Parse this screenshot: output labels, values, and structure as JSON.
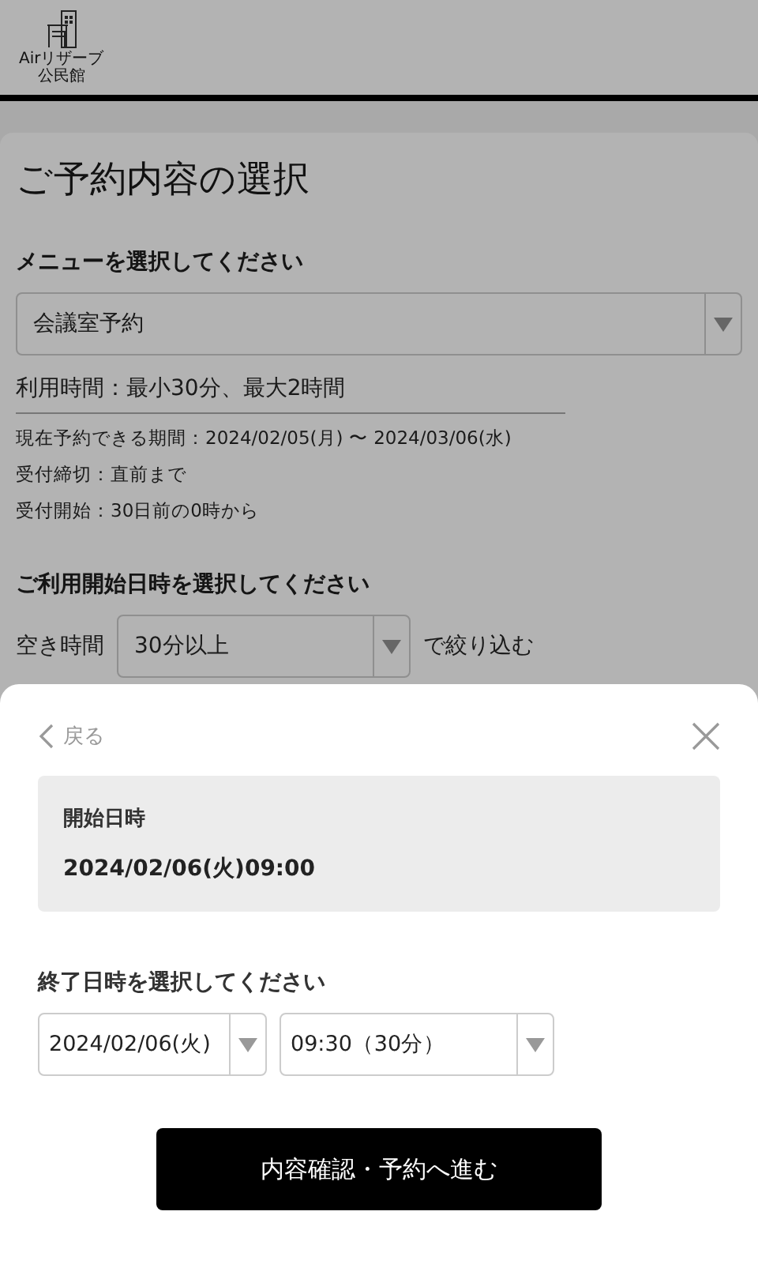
{
  "header": {
    "logo_text": [
      "Airリザーブ",
      "公民館"
    ]
  },
  "page": {
    "title": "ご予約内容の選択",
    "menu_label": "メニューを選択してください",
    "menu_select": "会議室予約",
    "usage_time": "利用時間：最小30分、最大2時間",
    "notes": [
      "現在予約できる期間：2024/02/05(月) 〜 2024/03/06(水)",
      "受付締切：直前まで",
      "受付開始：30日前の0時から"
    ],
    "start_label": "ご利用開始日時を選択してください",
    "filter": {
      "label": "空き時間",
      "select": "30分以上",
      "suffix": "で絞り込む"
    }
  },
  "sheet": {
    "back": "戻る",
    "start": {
      "label": "開始日時",
      "value": "2024/02/06(火)09:00"
    },
    "end_label": "終了日時を選択してください",
    "end_selects": [
      "2024/02/06(火)",
      "09:30（30分）"
    ],
    "submit": "内容確認・予約へ進む"
  }
}
